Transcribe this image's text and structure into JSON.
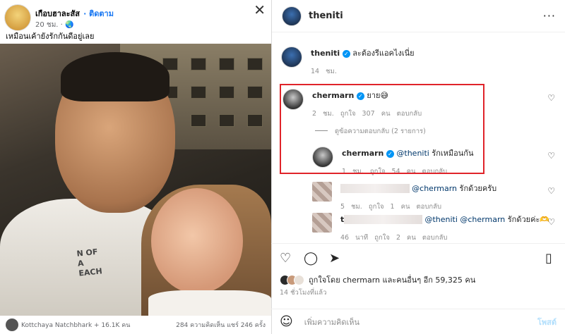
{
  "fb": {
    "name": "เกือบฮาละสัส",
    "follow": "· ติดตาม",
    "time": "20 ชม. · 🌏",
    "caption": "เหมือนเค้ายังรักกันดีอยู่เลย",
    "close": "✕",
    "shirt_text": "N OF\nA\nEACH",
    "footer_user": "Kottchaya Natchbhark + 16.1K คน",
    "footer_stats": "284 ความคิดเห็น  แชร์ 246 ครั้ง"
  },
  "ig": {
    "username": "theniti",
    "more": "···",
    "caption": {
      "user": "theniti",
      "text": "ละต้องรีแอคไงเนี่ย",
      "time": "14 ชม."
    },
    "comments": [
      {
        "user": "chermarn",
        "text": "ยาย😅",
        "time": "2 ชม.",
        "likes": "ถูกใจ 307 คน",
        "reply": "ตอบกลับ"
      },
      {
        "user": "chermarn",
        "mention": "@theniti",
        "text": "รักเหมือนกัน",
        "time": "1 ชม.",
        "likes": "ถูกใจ 54 คน",
        "reply": "ตอบกลับ"
      },
      {
        "mention": "@chermarn",
        "text": "รักด้วยครับ",
        "time": "5 ชม.",
        "likes": "ถูกใจ 1 คน",
        "reply": "ตอบกลับ"
      },
      {
        "user_prefix": "t",
        "mention": "@theniti @chermarn",
        "text": "รักด้วยค่ะ🫶",
        "time": "46 นาที",
        "likes": "ถูกใจ 2 คน",
        "reply": "ตอบกลับ"
      }
    ],
    "view_replies": "ดูข้อความตอบกลับ (2 รายการ)",
    "liked_by": "ถูกใจโดย chermarn และคนอื่นๆ อีก 59,325 คน",
    "ago": "14 ชั่วโมงที่แล้ว",
    "add_comment_placeholder": "เพิ่มความคิดเห็น",
    "post_label": "โพสต์"
  }
}
